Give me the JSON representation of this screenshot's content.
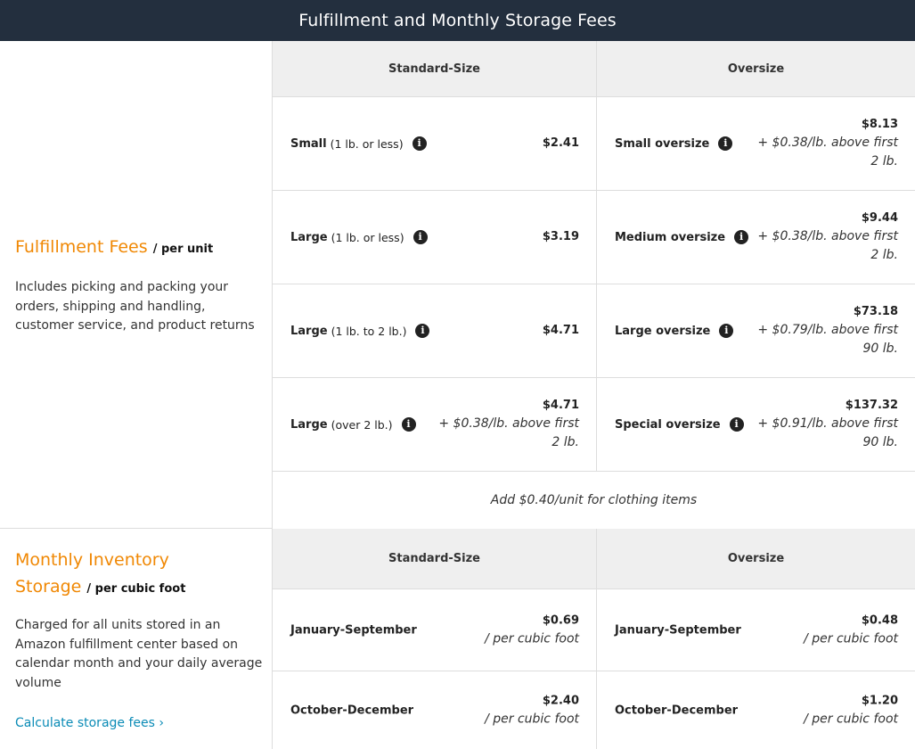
{
  "header": {
    "title": "Fulfillment and Monthly Storage Fees"
  },
  "fulfillment": {
    "title": "Fulfillment Fees",
    "unit": "/ per unit",
    "description": "Includes picking and packing your orders, shipping and handling, customer service, and product returns",
    "col_standard": "Standard-Size",
    "col_oversize": "Oversize",
    "rows": [
      {
        "std_label": "Small",
        "std_qual": "(1 lb. or less)",
        "std_price": "$2.41",
        "std_extra": "",
        "ov_label": "Small oversize",
        "ov_price": "$8.13",
        "ov_extra": "+ $0.38/lb. above first 2 lb."
      },
      {
        "std_label": "Large",
        "std_qual": "(1 lb. or less)",
        "std_price": "$3.19",
        "std_extra": "",
        "ov_label": "Medium oversize",
        "ov_price": "$9.44",
        "ov_extra": "+ $0.38/lb. above first 2 lb."
      },
      {
        "std_label": "Large",
        "std_qual": "(1 lb. to 2 lb.)",
        "std_price": "$4.71",
        "std_extra": "",
        "ov_label": "Large oversize",
        "ov_price": "$73.18",
        "ov_extra": "+ $0.79/lb. above first 90 lb."
      },
      {
        "std_label": "Large",
        "std_qual": "(over 2 lb.)",
        "std_price": "$4.71",
        "std_extra": "+ $0.38/lb. above first 2 lb.",
        "ov_label": "Special oversize",
        "ov_price": "$137.32",
        "ov_extra": "+ $0.91/lb. above first 90 lb."
      }
    ],
    "note": "Add $0.40/unit for clothing items"
  },
  "storage": {
    "title_line1": "Monthly Inventory",
    "title_line2": "Storage",
    "unit": "/ per cubic foot",
    "description": "Charged for all units stored in an Amazon fulfillment center based on calendar month and your daily average volume",
    "link": "Calculate storage fees ›",
    "col_standard": "Standard-Size",
    "col_oversize": "Oversize",
    "rows": [
      {
        "label": "January-September",
        "std_price": "$0.69",
        "std_extra": "/ per cubic foot",
        "ov_price": "$0.48",
        "ov_extra": "/ per cubic foot"
      },
      {
        "label": "October-December",
        "std_price": "$2.40",
        "std_extra": "/ per cubic foot",
        "ov_price": "$1.20",
        "ov_extra": "/ per cubic foot"
      }
    ]
  },
  "icons": {
    "info": "info-icon"
  },
  "colors": {
    "header_bg": "#232f3e",
    "accent": "#f08804",
    "link": "#0a8bb6"
  }
}
